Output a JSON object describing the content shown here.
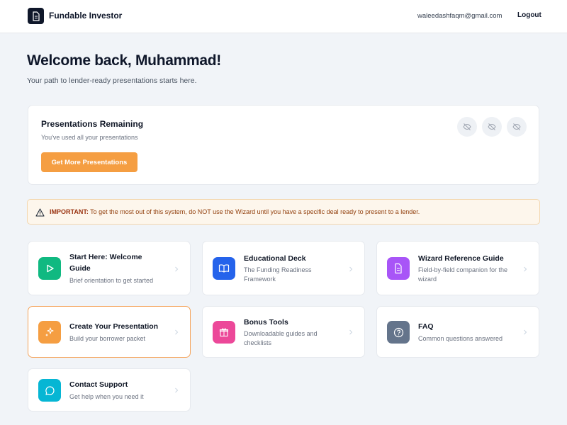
{
  "header": {
    "brand": "Fundable Investor",
    "email": "waleedashfaqm@gmail.com",
    "logout_label": "Logout",
    "logo_icon": "document-icon"
  },
  "hero": {
    "title": "Welcome back, Muhammad!",
    "subtitle": "Your path to lender-ready presentations starts here."
  },
  "presentations": {
    "title": "Presentations Remaining",
    "status": "You've used all your presentations",
    "button_label": "Get More Presentations",
    "remaining": 0,
    "total": 3,
    "slot_icon": "eye-off-icon"
  },
  "alert": {
    "label": "IMPORTANT:",
    "text": " To get the most out of this system, do NOT use the Wizard until you have a specific deal ready to present to a lender.",
    "icon": "warning-triangle-icon"
  },
  "cards": [
    {
      "title": "Start Here: Welcome Guide",
      "desc": "Brief orientation to get started",
      "icon": "play-icon",
      "color": "#10b981"
    },
    {
      "title": "Educational Deck",
      "desc": "The Funding Readiness Framework",
      "icon": "book-open-icon",
      "color": "#2563eb"
    },
    {
      "title": "Wizard Reference Guide",
      "desc": "Field-by-field companion for the wizard",
      "icon": "file-text-icon",
      "color": "#a855f7"
    },
    {
      "title": "Create Your Presentation",
      "desc": "Build your borrower packet",
      "icon": "sparkles-icon",
      "color": "#f59e42",
      "active": true
    },
    {
      "title": "Bonus Tools",
      "desc": "Downloadable guides and checklists",
      "icon": "gift-icon",
      "color": "#ec4899"
    },
    {
      "title": "FAQ",
      "desc": "Common questions answered",
      "icon": "help-circle-icon",
      "color": "#64748b"
    },
    {
      "title": "Contact Support",
      "desc": "Get help when you need it",
      "icon": "message-circle-icon",
      "color": "#06b6d4"
    }
  ]
}
